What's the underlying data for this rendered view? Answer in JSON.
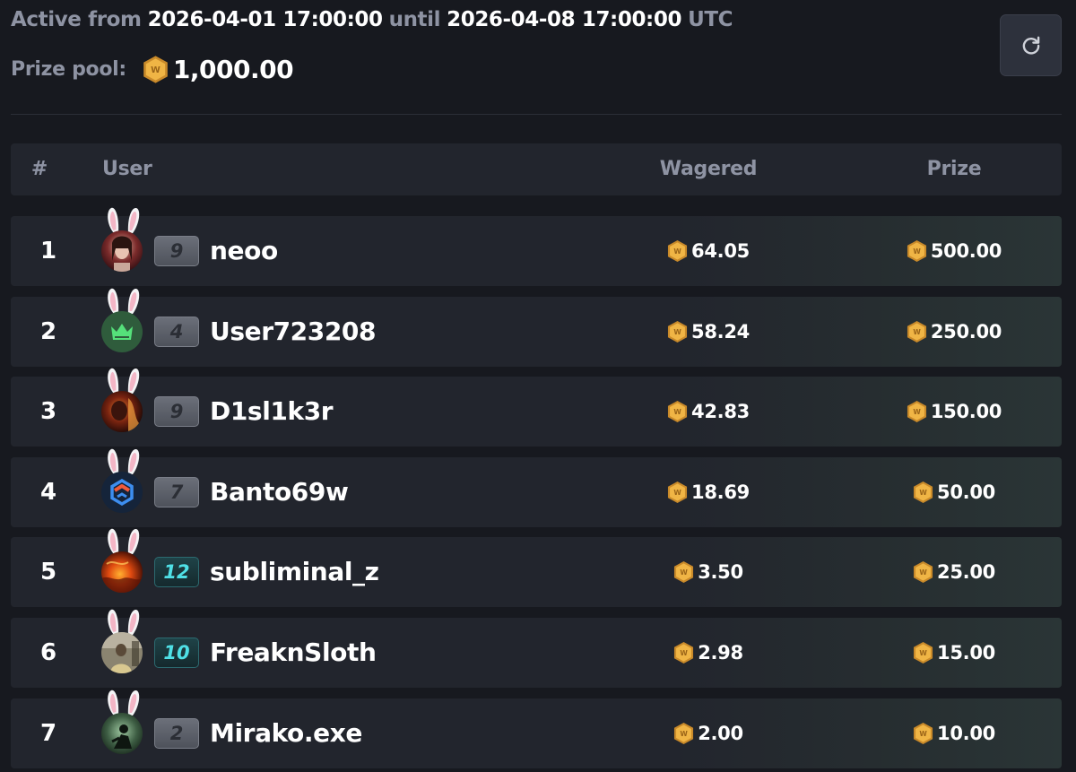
{
  "header": {
    "active_from_label": "Active from",
    "start": "2026-04-01 17:00:00",
    "until_label": "until",
    "end": "2026-04-08 17:00:00",
    "timezone": "UTC",
    "prize_pool_label": "Prize pool:",
    "prize_pool_value": "1,000.00",
    "refresh_icon": "refresh-icon"
  },
  "table": {
    "columns": {
      "rank": "#",
      "user": "User",
      "wagered": "Wagered",
      "prize": "Prize"
    },
    "rows": [
      {
        "rank": "1",
        "level": "9",
        "level_style": "grey",
        "username": "neoo",
        "wagered": "64.05",
        "prize": "500.00",
        "avatar": "portrait-avatar"
      },
      {
        "rank": "2",
        "level": "4",
        "level_style": "grey",
        "username": "User723208",
        "wagered": "58.24",
        "prize": "250.00",
        "avatar": "crown-logo-avatar"
      },
      {
        "rank": "3",
        "level": "9",
        "level_style": "grey",
        "username": "D1sl1k3r",
        "wagered": "42.83",
        "prize": "150.00",
        "avatar": "fire-portrait-avatar"
      },
      {
        "rank": "4",
        "level": "7",
        "level_style": "grey",
        "username": "Banto69w",
        "wagered": "18.69",
        "prize": "50.00",
        "avatar": "hex-logo-avatar"
      },
      {
        "rank": "5",
        "level": "12",
        "level_style": "teal",
        "username": "subliminal_z",
        "wagered": "3.50",
        "prize": "25.00",
        "avatar": "lava-avatar"
      },
      {
        "rank": "6",
        "level": "10",
        "level_style": "teal",
        "username": "FreaknSloth",
        "wagered": "2.98",
        "prize": "15.00",
        "avatar": "photo-avatar"
      },
      {
        "rank": "7",
        "level": "2",
        "level_style": "grey",
        "username": "Mirako.exe",
        "wagered": "2.00",
        "prize": "10.00",
        "avatar": "silhouette-avatar"
      }
    ]
  },
  "colors": {
    "background": "#17191f",
    "row": "#22252d",
    "muted_text": "#8e93a3",
    "coin_gold": "#e8a93a",
    "teal_level": "#4fe0e6"
  }
}
